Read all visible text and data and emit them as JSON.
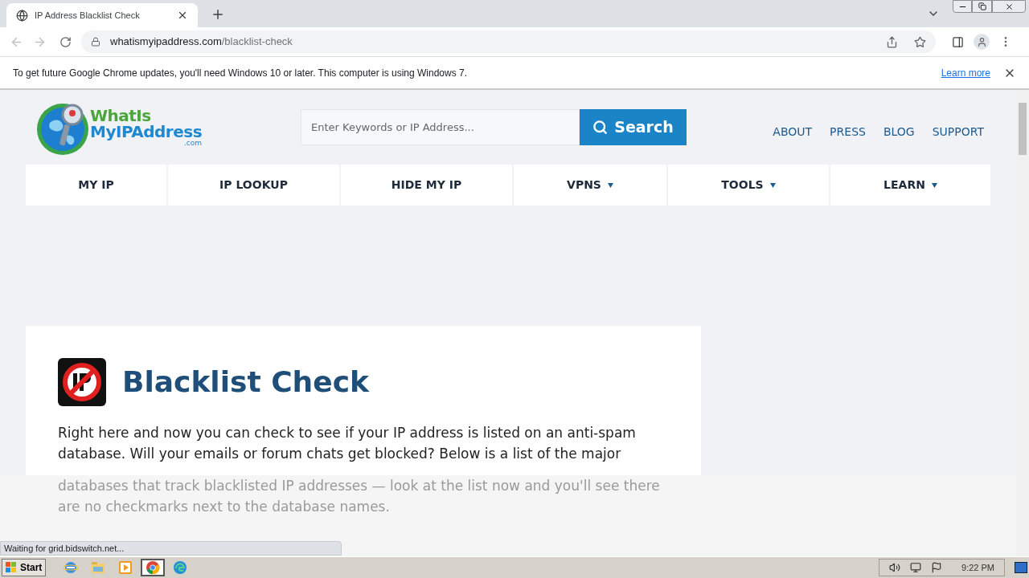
{
  "browser": {
    "tab_title": "IP Address Blacklist Check",
    "url_host": "whatismyipaddress.com",
    "url_path": "/blacklist-check",
    "infobar": {
      "message": "To get future Google Chrome updates, you'll need Windows 10 or later. This computer is using Windows 7.",
      "link": "Learn more"
    },
    "status": "Waiting for grid.bidswitch.net..."
  },
  "site": {
    "logo": {
      "line1": "WhatIs",
      "line2": "MyIPAddress",
      "line3": ".com"
    },
    "search": {
      "placeholder": "Enter Keywords or IP Address...",
      "button": "Search"
    },
    "top_links": [
      "ABOUT",
      "PRESS",
      "BLOG",
      "SUPPORT"
    ],
    "nav": [
      {
        "label": "MY IP",
        "has_menu": false
      },
      {
        "label": "IP LOOKUP",
        "has_menu": false
      },
      {
        "label": "HIDE MY IP",
        "has_menu": false
      },
      {
        "label": "VPNS",
        "has_menu": true
      },
      {
        "label": "TOOLS",
        "has_menu": true
      },
      {
        "label": "LEARN",
        "has_menu": true
      }
    ],
    "article": {
      "title": "Blacklist Check",
      "text": "Right here and now you can check to see if your IP address is listed on an anti-spam database. Will your emails or forum chats get blocked? Below is a list of the major",
      "faded_text": "databases that track blacklisted IP addresses — look at the list now and you'll see there are no checkmarks next to the database names."
    }
  },
  "taskbar": {
    "start": "Start",
    "apps": [
      {
        "kind": "ie",
        "selected": false
      },
      {
        "kind": "folder",
        "selected": false
      },
      {
        "kind": "media",
        "selected": false
      },
      {
        "kind": "chrome",
        "selected": true
      },
      {
        "kind": "edge",
        "selected": false
      }
    ],
    "clock": "9:22 PM"
  }
}
